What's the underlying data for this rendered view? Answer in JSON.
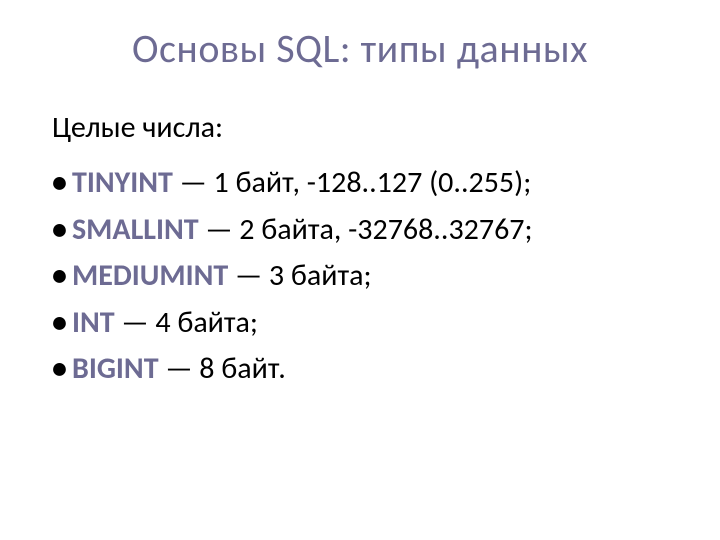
{
  "title": "Основы SQL: типы данных",
  "subtitle": "Целые числа:",
  "items": [
    {
      "name": "TINYINT",
      "desc": " — 1 байт, -128..127 (0..255);"
    },
    {
      "name": "SMALLINT",
      "desc": " — 2 байта, -32768..32767;"
    },
    {
      "name": "MEDIUMINT",
      "desc": "  — 3 байта;"
    },
    {
      "name": "INT",
      "desc": " — 4 байта;"
    },
    {
      "name": "BIGINT",
      "desc": " — 8 байт."
    }
  ]
}
